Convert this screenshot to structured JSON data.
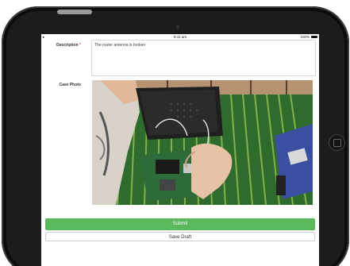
{
  "status_bar": {
    "left": "▸",
    "time": "9:41 am",
    "battery": "100%"
  },
  "form": {
    "description_label": "Description",
    "required_marker": "*",
    "description_value": "The router antenna is broken",
    "photo_label": "Case Photo",
    "submit_label": "Submit",
    "draft_label": "Save Draft"
  },
  "colors": {
    "submit": "#5cb85c",
    "frame": "#1c1c1e"
  }
}
